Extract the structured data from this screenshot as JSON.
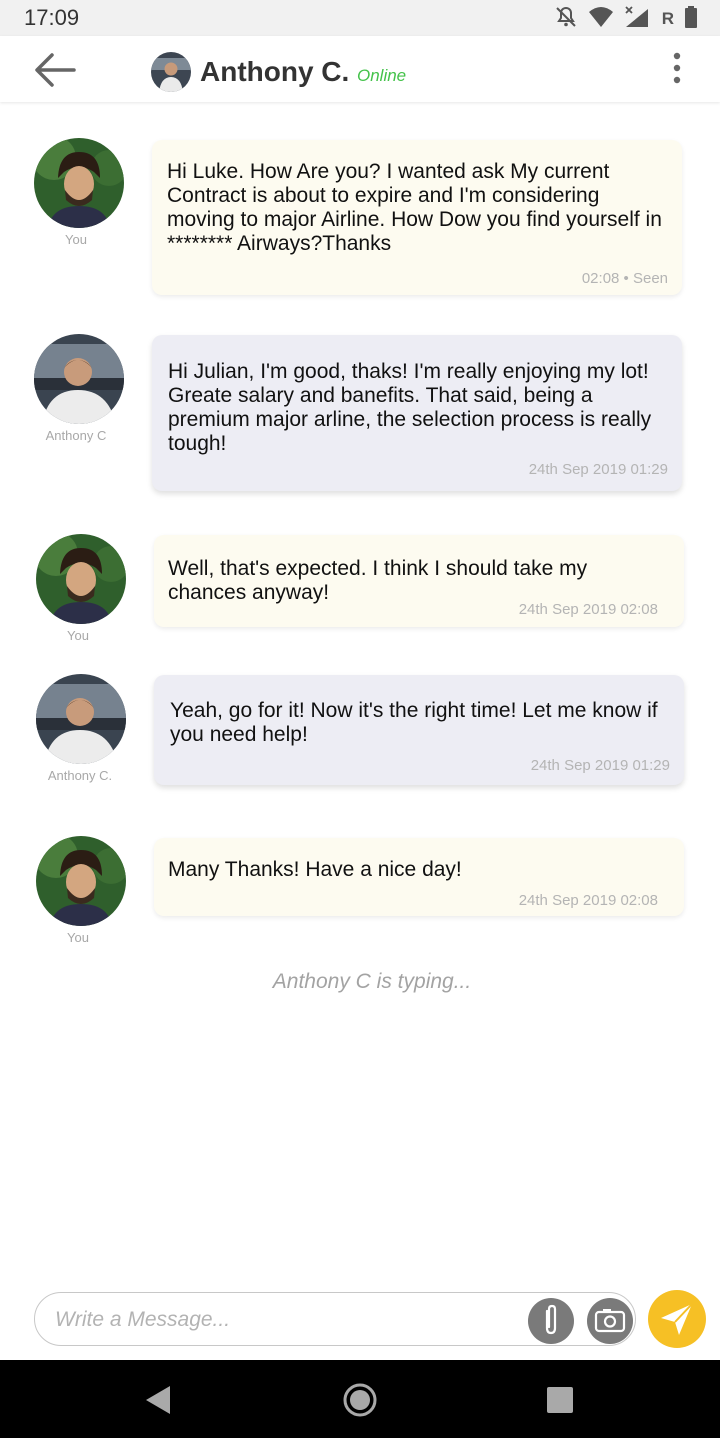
{
  "status_bar": {
    "time": "17:09",
    "carrier_letter": "R",
    "icons": [
      "notifications-off-icon",
      "wifi-icon",
      "cellular-signal-icon",
      "battery-icon"
    ]
  },
  "header": {
    "contact_name": "Anthony C.",
    "status": "Online",
    "icons": [
      "back-arrow-icon",
      "more-vertical-icon"
    ]
  },
  "messages": [
    {
      "from": "me",
      "sender_label": "You",
      "text": "Hi Luke. How Are you? I wanted ask My current Contract is about to expire and I'm considering moving to major Airline. How Dow you find yourself in ******** Airways?Thanks",
      "meta": "02:08 • Seen"
    },
    {
      "from": "them",
      "sender_label": "Anthony C",
      "text": "Hi Julian, I'm good, thaks!  I'm really enjoying my lot! Greate salary and banefits. That said,  being a premium major arline, the selection process is really tough!",
      "meta": "24th Sep 2019 01:29"
    },
    {
      "from": "me",
      "sender_label": "You",
      "text": "Well, that's expected. I think I should take my chances anyway!",
      "meta": "24th Sep 2019  02:08"
    },
    {
      "from": "them",
      "sender_label": "Anthony C.",
      "text": "Yeah, go for it! Now it's the right time! Let me know if you need help!",
      "meta": "24th Sep 2019 01:29"
    },
    {
      "from": "me",
      "sender_label": "You",
      "text": "Many Thanks! Have a nice day!",
      "meta": "24th Sep 2019  02:08"
    }
  ],
  "typing_indicator": "Anthony C is typing...",
  "composer": {
    "placeholder": "Write a Message...",
    "value": "",
    "icons": [
      "paperclip-icon",
      "camera-icon",
      "send-icon"
    ]
  },
  "colors": {
    "online": "#44c24a",
    "send_button": "#f6c025",
    "my_bubble": "#fdfbf0",
    "their_bubble": "#ededf4"
  }
}
